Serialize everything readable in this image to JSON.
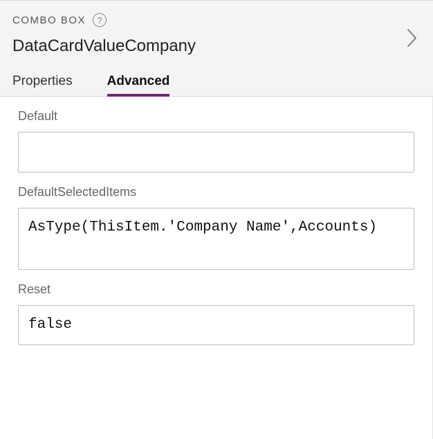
{
  "header": {
    "typeLabel": "COMBO BOX",
    "helpTooltip": "?",
    "controlName": "DataCardValueCompany"
  },
  "tabs": [
    {
      "label": "Properties",
      "active": false
    },
    {
      "label": "Advanced",
      "active": true
    }
  ],
  "properties": [
    {
      "name": "Default",
      "value": ""
    },
    {
      "name": "DefaultSelectedItems",
      "value": "AsType(ThisItem.'Company Name',Accounts)"
    },
    {
      "name": "Reset",
      "value": "false"
    }
  ]
}
